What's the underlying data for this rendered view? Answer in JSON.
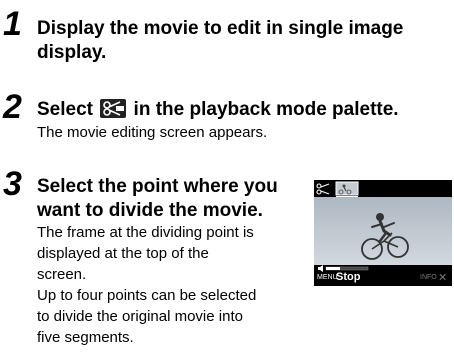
{
  "steps": [
    {
      "number": "1",
      "title_line1": "Display the movie to edit in single image",
      "title_line2": "display."
    },
    {
      "number": "2",
      "title_before": "Select",
      "title_icon": "movie-edit-icon",
      "title_after": "in the playback mode palette.",
      "body": "The movie editing screen appears."
    },
    {
      "number": "3",
      "title_line1": "Select the point where you",
      "title_line2": "want to divide the movie.",
      "body_lines": [
        "The frame at the dividing point is",
        "displayed at the top of the",
        "screen.",
        "Up to four points can be selected",
        "to divide the original movie into",
        "five segments."
      ]
    }
  ],
  "camera_screen": {
    "menu_label": "MENU",
    "stop_label": "Stop",
    "info_label": "INFO",
    "top_left_icon": "scissors-icon",
    "volume_icon": "speaker-icon",
    "cancel_icon": "cross-icon"
  }
}
